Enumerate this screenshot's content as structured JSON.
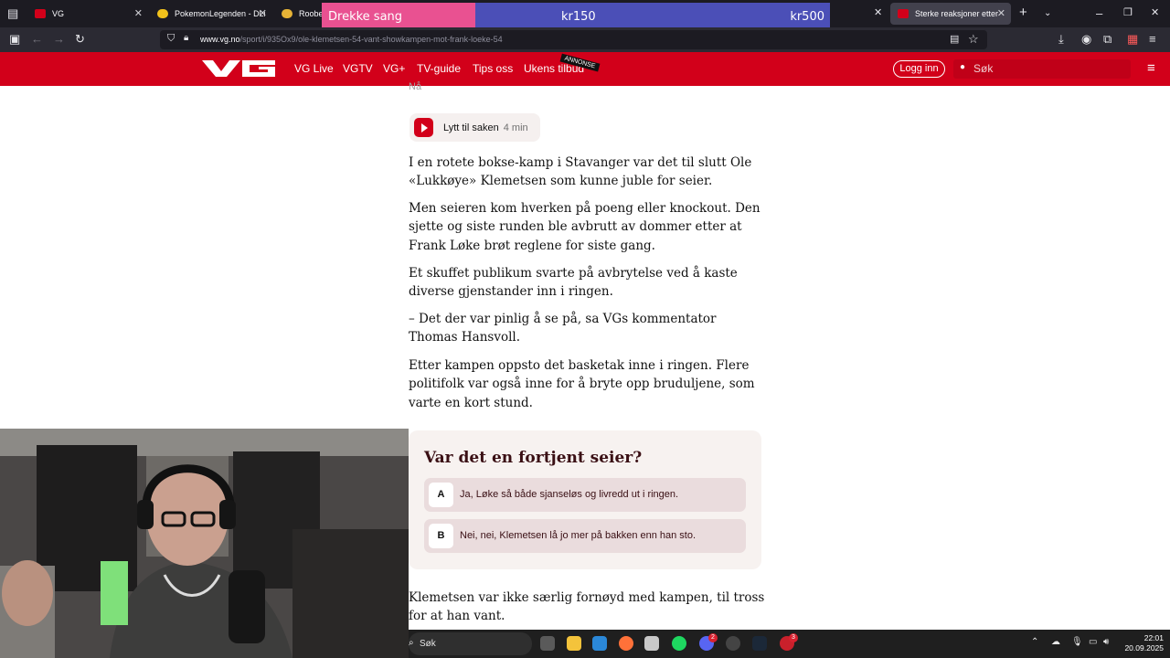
{
  "browser": {
    "tabs": [
      {
        "label": "VG",
        "favicon_color": "#d2001a",
        "active": false
      },
      {
        "label": "PokemonLegenden - DLive",
        "favicon_color": "#f2c21b",
        "active": false
      },
      {
        "label": "Roobet |",
        "favicon_color": "#e7b336",
        "active": false
      },
      {
        "label": "Sterke reaksjoner etter at Fr",
        "favicon_color": "#d2001a",
        "active": true
      }
    ],
    "url_domain": "www.vg.no",
    "url_path": "/sport/i/935Ox9/ole-klemetsen-54-vant-showkampen-mot-frank-loeke-54"
  },
  "song_overlay": {
    "title": "Drekke sang",
    "price_min": "kr150",
    "price_max": "kr500"
  },
  "vg_header": {
    "logo": "VG",
    "nav_items": [
      "VG Live",
      "VGTV",
      "VG+",
      "TV-guide",
      "Tips oss",
      "Ukens tilbud"
    ],
    "annonse_badge": "ANNONSE",
    "login_label": "Logg inn",
    "search_placeholder": "Søk"
  },
  "article": {
    "timestamp": "Nå",
    "listen_label": "Lytt til saken",
    "listen_duration": "4 min",
    "paragraphs": [
      "I en rotete bokse-kamp i Stavanger var det til slutt Ole «Lukkøye» Klemetsen som kunne juble for seier.",
      "Men seieren kom hverken på poeng eller knockout. Den sjette og siste runden ble avbrutt av dommer etter at Frank Løke brøt reglene for siste gang.",
      "Et skuffet publikum svarte på avbrytelse ved å kaste diverse gjenstander inn i ringen.",
      "– Det der var pinlig å se på, sa VGs kommentator Thomas Hansvoll.",
      "Etter kampen oppsto det basketak inne i ringen. Flere politifolk var også inne for å bryte opp bruduljene, som varte en kort stund.",
      "Klemetsen var ikke særlig fornøyd med kampen, til tross for at han vant."
    ]
  },
  "poll": {
    "question": "Var det en fortjent seier?",
    "options": [
      {
        "letter": "A",
        "text": "Ja, Løke så både sjanseløs og livredd ut i ringen."
      },
      {
        "letter": "B",
        "text": "Nei, nei, Klemetsen lå jo mer på bakken enn han sto."
      }
    ]
  },
  "taskbar": {
    "search_placeholder": "Søk",
    "badges": {
      "discord": "2",
      "steam_alt": "3"
    },
    "time": "22:01",
    "date": "20.09.2025"
  }
}
